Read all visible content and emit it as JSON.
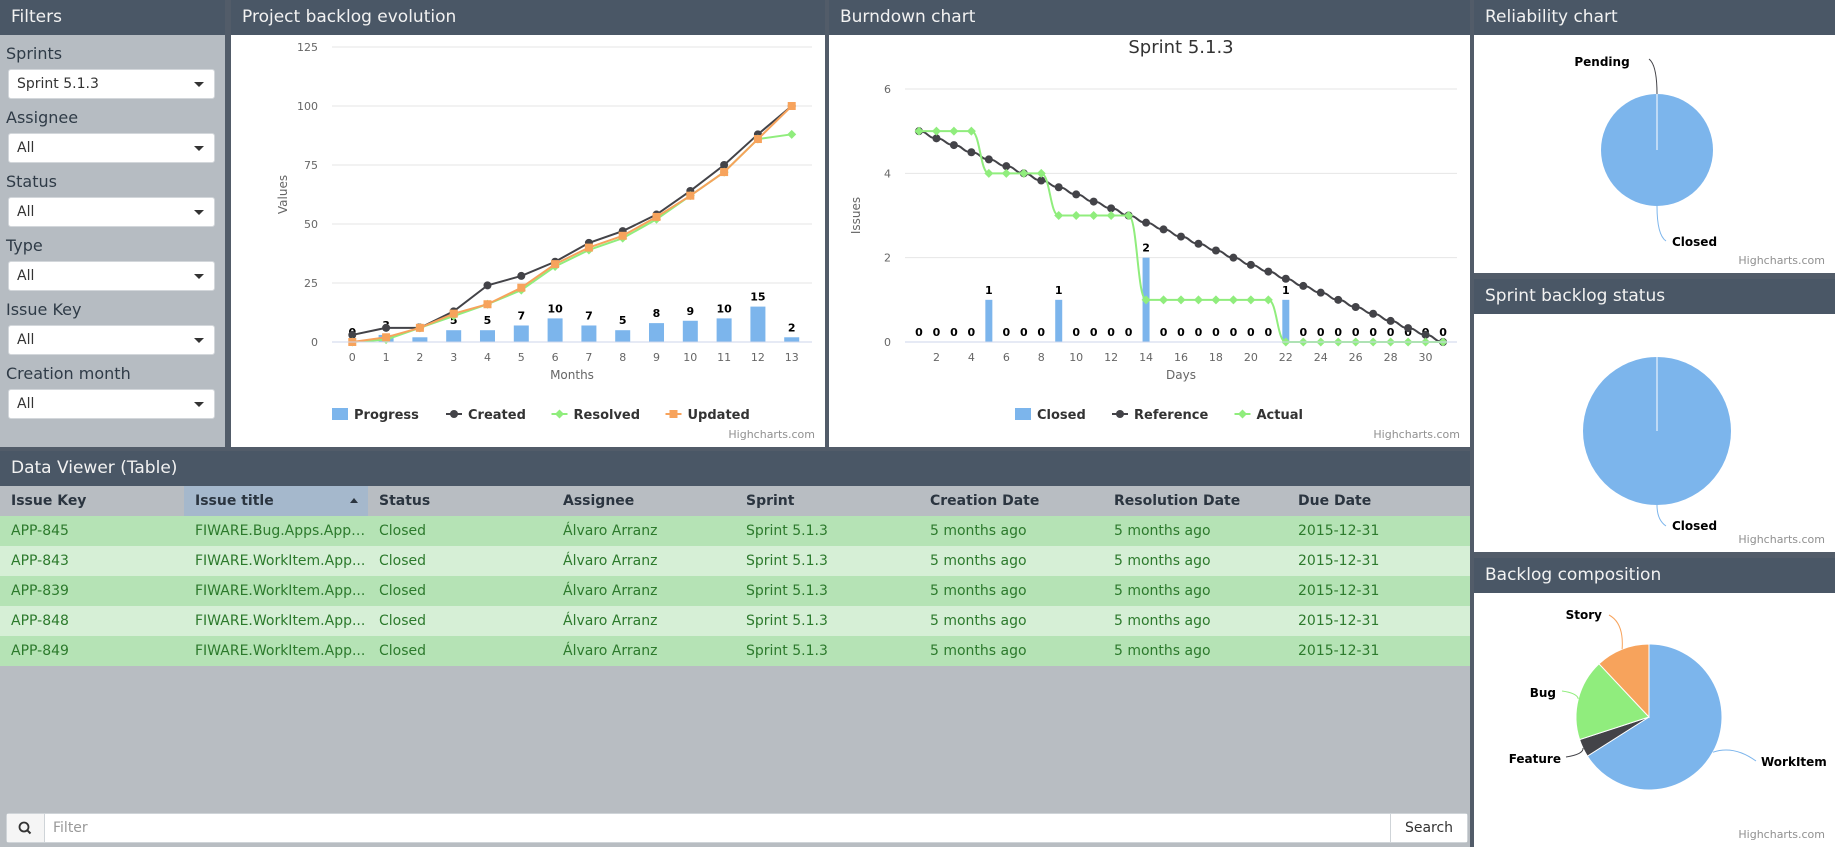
{
  "filters": {
    "title": "Filters",
    "items": [
      {
        "label": "Sprints",
        "value": "Sprint 5.1.3"
      },
      {
        "label": "Assignee",
        "value": "All"
      },
      {
        "label": "Status",
        "value": "All"
      },
      {
        "label": "Type",
        "value": "All"
      },
      {
        "label": "Issue Key",
        "value": "All"
      },
      {
        "label": "Creation month",
        "value": "All"
      }
    ]
  },
  "credits": "Highcharts.com",
  "chart_data": [
    {
      "panel_title": "Project backlog evolution",
      "type": "line",
      "x": [
        0,
        1,
        2,
        3,
        4,
        5,
        6,
        7,
        8,
        9,
        10,
        11,
        12,
        13
      ],
      "xlabel": "Months",
      "ylabel": "Values",
      "ylim": [
        0,
        125
      ],
      "yticks": [
        0,
        25,
        50,
        75,
        100,
        125
      ],
      "legend_position": "bottom",
      "series": [
        {
          "name": "Progress",
          "kind": "bar",
          "color": "#7cb5ec",
          "values": [
            0,
            3,
            2,
            5,
            5,
            7,
            10,
            7,
            5,
            8,
            9,
            10,
            15,
            2
          ]
        },
        {
          "name": "Created",
          "kind": "line",
          "color": "#434348",
          "marker": "circle",
          "values": [
            3,
            6,
            6,
            13,
            24,
            28,
            34,
            42,
            47,
            54,
            64,
            75,
            88,
            100
          ]
        },
        {
          "name": "Resolved",
          "kind": "line",
          "color": "#90ed7d",
          "marker": "diamond",
          "values": [
            0,
            1,
            6,
            11,
            16,
            22,
            32,
            39,
            44,
            52,
            62,
            72,
            86,
            88
          ]
        },
        {
          "name": "Updated",
          "kind": "line",
          "color": "#f7a35c",
          "marker": "square",
          "values": [
            0,
            2,
            6,
            12,
            16,
            23,
            33,
            40,
            45,
            53,
            62,
            72,
            86,
            100
          ]
        }
      ]
    },
    {
      "panel_title": "Burndown chart",
      "type": "line",
      "title": "Sprint 5.1.3",
      "x": [
        1,
        2,
        3,
        4,
        5,
        6,
        7,
        8,
        9,
        10,
        11,
        12,
        13,
        14,
        15,
        16,
        17,
        18,
        19,
        20,
        21,
        22,
        23,
        24,
        25,
        26,
        27,
        28,
        29,
        30,
        31
      ],
      "xticks": [
        2,
        4,
        6,
        8,
        10,
        12,
        14,
        16,
        18,
        20,
        22,
        24,
        26,
        28,
        30
      ],
      "xlabel": "Days",
      "ylabel": "Issues",
      "ylim": [
        0,
        6
      ],
      "yticks": [
        0,
        2,
        4,
        6
      ],
      "legend_position": "bottom",
      "series": [
        {
          "name": "Closed",
          "kind": "bar",
          "color": "#7cb5ec",
          "values": [
            0,
            0,
            0,
            0,
            1,
            0,
            0,
            0,
            1,
            0,
            0,
            0,
            0,
            2,
            0,
            0,
            0,
            0,
            0,
            0,
            0,
            1,
            0,
            0,
            0,
            0,
            0,
            0,
            0,
            0,
            0
          ]
        },
        {
          "name": "Reference",
          "kind": "line",
          "color": "#434348",
          "marker": "circle",
          "values": [
            5,
            4.83,
            4.67,
            4.5,
            4.33,
            4.17,
            4,
            3.83,
            3.67,
            3.5,
            3.33,
            3.17,
            3,
            2.83,
            2.67,
            2.5,
            2.33,
            2.17,
            2,
            1.83,
            1.67,
            1.5,
            1.33,
            1.17,
            1,
            0.83,
            0.67,
            0.5,
            0.33,
            0.17,
            0
          ]
        },
        {
          "name": "Actual",
          "kind": "line",
          "color": "#90ed7d",
          "marker": "diamond",
          "values": [
            5,
            5,
            5,
            5,
            4,
            4,
            4,
            4,
            3,
            3,
            3,
            3,
            3,
            1,
            1,
            1,
            1,
            1,
            1,
            1,
            1,
            0,
            0,
            0,
            0,
            0,
            0,
            0,
            0,
            0,
            0
          ]
        }
      ]
    },
    {
      "panel_title": "Reliability chart",
      "type": "pie",
      "slices": [
        {
          "name": "Pending",
          "value": 0,
          "color": "#434348"
        },
        {
          "name": "Closed",
          "value": 100,
          "color": "#7cb5ec"
        }
      ]
    },
    {
      "panel_title": "Sprint backlog status",
      "type": "pie",
      "slices": [
        {
          "name": "Closed",
          "value": 100,
          "color": "#7cb5ec"
        }
      ]
    },
    {
      "panel_title": "Backlog composition",
      "type": "pie",
      "slices": [
        {
          "name": "WorkItem",
          "value": 66,
          "color": "#7cb5ec"
        },
        {
          "name": "Feature",
          "value": 4,
          "color": "#434348"
        },
        {
          "name": "Bug",
          "value": 18,
          "color": "#90ed7d"
        },
        {
          "name": "Story",
          "value": 12,
          "color": "#f7a35c"
        }
      ]
    }
  ],
  "table": {
    "title": "Data Viewer (Table)",
    "columns": [
      "Issue Key",
      "Issue title",
      "Status",
      "Assignee",
      "Sprint",
      "Creation Date",
      "Resolution Date",
      "Due Date"
    ],
    "sorted_column": "Issue title",
    "rows": [
      [
        "APP-845",
        "FIWARE.Bug.Apps.Appl...",
        "Closed",
        "Álvaro Arranz",
        "Sprint 5.1.3",
        "5 months ago",
        "5 months ago",
        "2015-12-31"
      ],
      [
        "APP-843",
        "FIWARE.WorkItem.App...",
        "Closed",
        "Álvaro Arranz",
        "Sprint 5.1.3",
        "5 months ago",
        "5 months ago",
        "2015-12-31"
      ],
      [
        "APP-839",
        "FIWARE.WorkItem.App...",
        "Closed",
        "Álvaro Arranz",
        "Sprint 5.1.3",
        "5 months ago",
        "5 months ago",
        "2015-12-31"
      ],
      [
        "APP-848",
        "FIWARE.WorkItem.App...",
        "Closed",
        "Álvaro Arranz",
        "Sprint 5.1.3",
        "5 months ago",
        "5 months ago",
        "2015-12-31"
      ],
      [
        "APP-849",
        "FIWARE.WorkItem.App...",
        "Closed",
        "Álvaro Arranz",
        "Sprint 5.1.3",
        "5 months ago",
        "5 months ago",
        "2015-12-31"
      ]
    ],
    "filter_placeholder": "Filter",
    "search_label": "Search",
    "search_icon": "search-icon"
  }
}
